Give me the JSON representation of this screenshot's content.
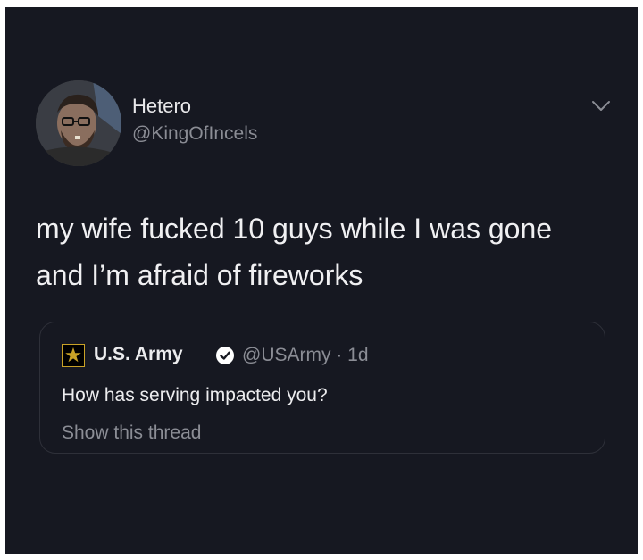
{
  "tweet": {
    "author_name": "Hetero",
    "author_handle": "@KingOfIncels",
    "text": "my wife fucked 10 guys while I was gone and I’m afraid of fireworks"
  },
  "quoted_tweet": {
    "author_name": "U.S. Army",
    "author_handle": "@USArmy · 1d",
    "text": "How has serving impacted you?",
    "show_thread_label": "Show this thread"
  },
  "icons": {
    "menu": "chevron-down-icon",
    "verified": "verified-badge-icon",
    "logo": "army-star-logo"
  },
  "colors": {
    "background": "#161821",
    "text": "#f0f0f2",
    "secondary_text": "#8b8d95",
    "border": "#2e3039"
  }
}
